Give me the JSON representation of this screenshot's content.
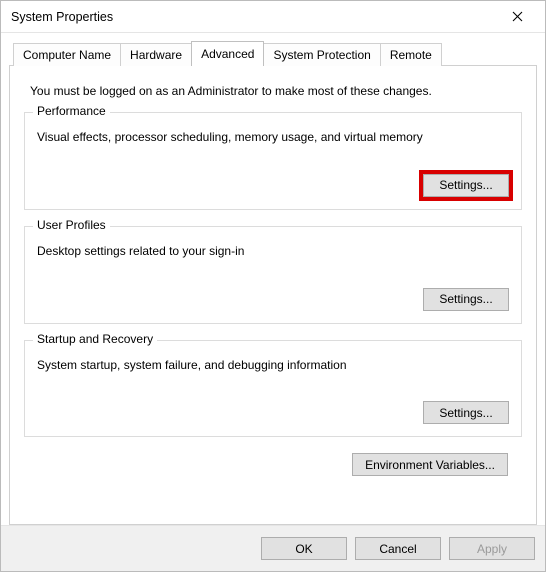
{
  "window": {
    "title": "System Properties"
  },
  "tabs": {
    "items": [
      {
        "label": "Computer Name"
      },
      {
        "label": "Hardware"
      },
      {
        "label": "Advanced"
      },
      {
        "label": "System Protection"
      },
      {
        "label": "Remote"
      }
    ],
    "activeIndex": 2
  },
  "panel": {
    "info": "You must be logged on as an Administrator to make most of these changes.",
    "groups": {
      "performance": {
        "title": "Performance",
        "desc": "Visual effects, processor scheduling, memory usage, and virtual memory",
        "button": "Settings..."
      },
      "userProfiles": {
        "title": "User Profiles",
        "desc": "Desktop settings related to your sign-in",
        "button": "Settings..."
      },
      "startupRecovery": {
        "title": "Startup and Recovery",
        "desc": "System startup, system failure, and debugging information",
        "button": "Settings..."
      }
    },
    "envVars": "Environment Variables..."
  },
  "footer": {
    "ok": "OK",
    "cancel": "Cancel",
    "apply": "Apply"
  }
}
